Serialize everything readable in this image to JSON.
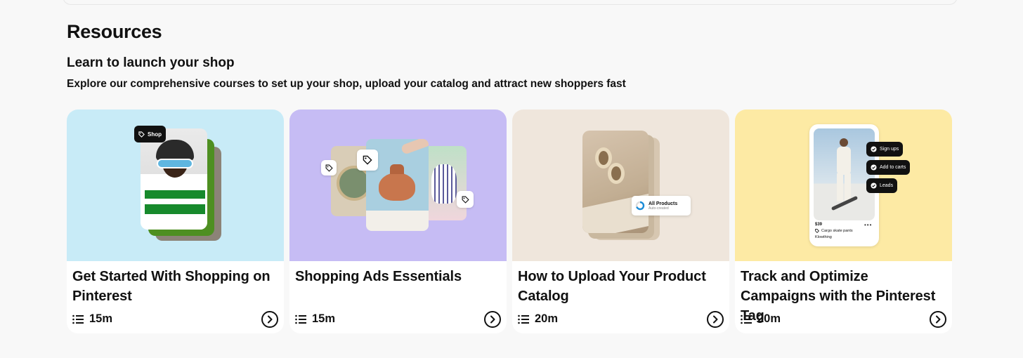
{
  "section": {
    "title": "Resources",
    "subtitle": "Learn to launch your shop",
    "description": "Explore our comprehensive courses to set up your shop, upload your catalog and attract new shoppers fast"
  },
  "courses": [
    {
      "title": "Get Started With Shopping on Pinterest",
      "duration": "15m",
      "bg": "#c8ebf7",
      "art": {
        "shop_pill": "Shop"
      }
    },
    {
      "title": "Shopping Ads Essentials",
      "duration": "15m",
      "bg": "#c6bcf4"
    },
    {
      "title": "How to Upload Your Product Catalog",
      "duration": "20m",
      "bg": "#efe6dc",
      "art": {
        "catalog_title": "All Products",
        "catalog_sub": "Auto-created"
      }
    },
    {
      "title": "Track and Optimize Campaigns with the Pinterest Tag",
      "duration": "20m",
      "bg": "#fdeaa4",
      "art": {
        "events": [
          "Sign ups",
          "Add to carts",
          "Leads"
        ],
        "price": "$39",
        "product": "Cargo skate pants",
        "brand": "Klowthing"
      }
    }
  ],
  "icons": {
    "duration": "list-icon",
    "open": "chevron-right-circle-icon",
    "tag": "tag-icon",
    "check": "check-circle-icon"
  }
}
